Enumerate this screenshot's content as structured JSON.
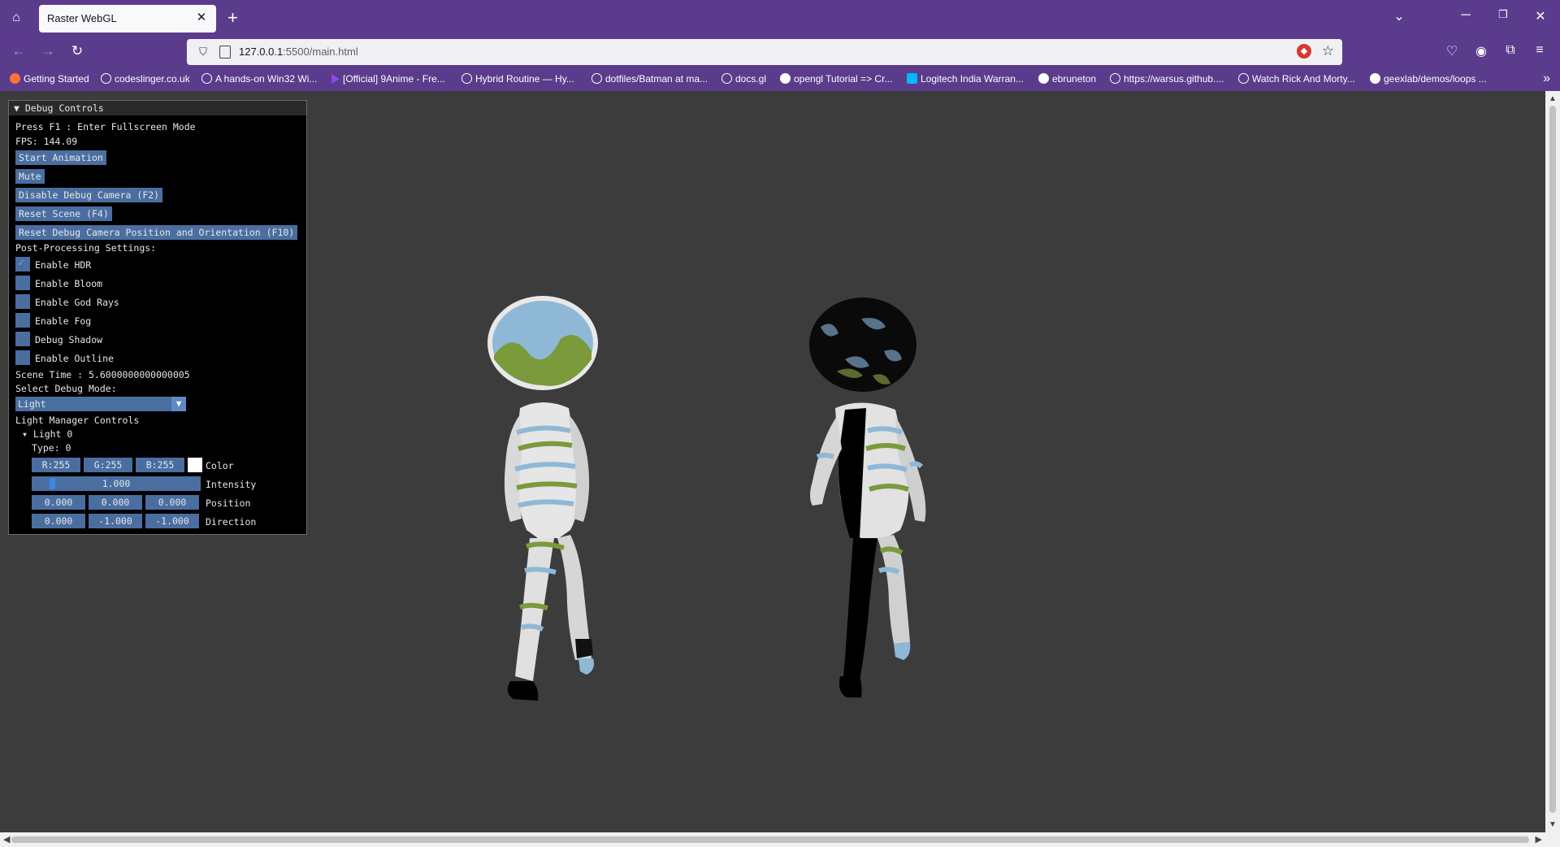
{
  "browser": {
    "tab_title": "Raster WebGL",
    "url_host": "127.0.0.1",
    "url_path": ":5500/main.html",
    "accent_color": "#5b3c8c"
  },
  "bookmarks": [
    {
      "label": "Getting Started",
      "icon": "firefox-icon"
    },
    {
      "label": "codeslinger.co.uk",
      "icon": "globe-icon"
    },
    {
      "label": "A hands-on Win32 Wi...",
      "icon": "globe-icon"
    },
    {
      "label": "[Official] 9Anime - Fre...",
      "icon": "play-icon"
    },
    {
      "label": "Hybrid Routine — Hy...",
      "icon": "globe-icon"
    },
    {
      "label": "dotfiles/Batman at ma...",
      "icon": "globe-icon"
    },
    {
      "label": "docs.gl",
      "icon": "globe-icon"
    },
    {
      "label": "opengl Tutorial => Cr...",
      "icon": "person-icon"
    },
    {
      "label": "Logitech India Warran...",
      "icon": "logitech-icon"
    },
    {
      "label": "ebruneton",
      "icon": "github-icon"
    },
    {
      "label": "https://warsus.github....",
      "icon": "globe-icon"
    },
    {
      "label": "Watch Rick And Morty...",
      "icon": "globe-icon"
    },
    {
      "label": "geexlab/demos/loops ...",
      "icon": "github-icon"
    }
  ],
  "debug": {
    "header": "Debug Controls",
    "fullscreen_hint": "Press F1 : Enter Fullscreen Mode",
    "fps": "FPS: 144.09",
    "buttons": {
      "start_animation": "Start Animation",
      "mute": "Mute",
      "disable_debug_camera": "Disable Debug Camera (F2)",
      "reset_scene": "Reset Scene (F4)",
      "reset_debug_camera": "Reset Debug Camera Position and Orientation (F10)"
    },
    "postprocessing_label": "Post-Processing Settings:",
    "checkboxes": [
      {
        "label": "Enable HDR",
        "checked": true
      },
      {
        "label": "Enable Bloom",
        "checked": false
      },
      {
        "label": "Enable God Rays",
        "checked": false
      },
      {
        "label": "Enable Fog",
        "checked": false
      },
      {
        "label": "Debug Shadow",
        "checked": false
      },
      {
        "label": "Enable Outline",
        "checked": false
      }
    ],
    "scene_time": "Scene Time : 5.6000000000000005",
    "debug_mode_label": "Select Debug Mode:",
    "debug_mode_value": "Light",
    "light_manager_label": "Light Manager Controls",
    "light_tree_label": "Light 0",
    "light_type": "Type: 0",
    "color": {
      "r": "R:255",
      "g": "G:255",
      "b": "B:255",
      "label": "Color",
      "value": "#ffffff"
    },
    "intensity": {
      "value": "1.000",
      "label": "Intensity"
    },
    "position": {
      "x": "0.000",
      "y": "0.000",
      "z": "0.000",
      "label": "Position"
    },
    "direction": {
      "x": "0.000",
      "y": "-1.000",
      "z": "-1.000",
      "label": "Direction"
    }
  }
}
